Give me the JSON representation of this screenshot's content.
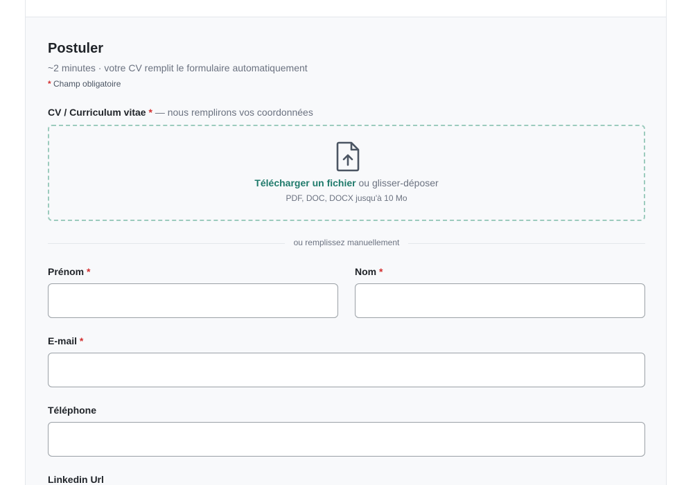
{
  "form": {
    "title": "Postuler",
    "subtitle": "~2 minutes · votre CV remplit le formulaire automatiquement",
    "required_mark": "*",
    "required_note": "Champ obligatoire",
    "cv": {
      "label": "CV / Curriculum vitae",
      "hint": "— nous remplirons vos coordonnées",
      "upload_link": "Télécharger un fichier",
      "upload_text": "ou glisser-déposer",
      "formats": "PDF, DOC, DOCX jusqu'à 10 Mo"
    },
    "divider": "ou remplissez manuellement",
    "fields": {
      "first_name": {
        "label": "Prénom",
        "value": ""
      },
      "last_name": {
        "label": "Nom",
        "value": ""
      },
      "email": {
        "label": "E-mail",
        "value": ""
      },
      "phone": {
        "label": "Téléphone",
        "value": ""
      },
      "linkedin": {
        "label": "Linkedin Url",
        "value": ""
      }
    },
    "colors": {
      "accent": "#1f7a6b",
      "required": "#d32f2f",
      "dropzone_border": "#9ccbbd"
    },
    "icons": {
      "upload": "file-upload-icon"
    }
  }
}
